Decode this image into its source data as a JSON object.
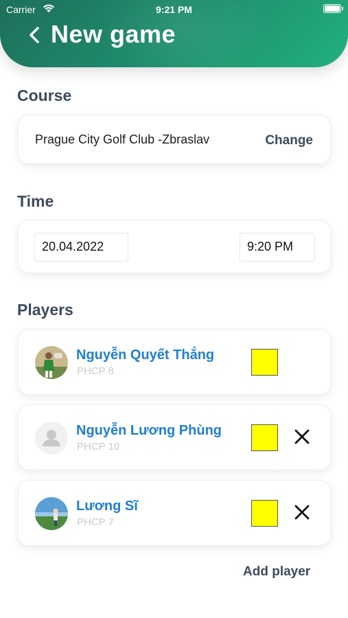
{
  "status_bar": {
    "carrier": "Carrier",
    "time": "9:21 PM"
  },
  "header": {
    "title": "New game",
    "back_icon": "chevron-left-icon"
  },
  "course": {
    "label": "Course",
    "name": "Prague City Golf Club -Zbraslav",
    "change_label": "Change"
  },
  "time": {
    "label": "Time",
    "date": "20.04.2022",
    "clock": "9:20 PM"
  },
  "players": {
    "label": "Players",
    "items": [
      {
        "name": "Nguyễn Quyết Thắng",
        "hcp": "PHCP 8",
        "color": "#ffff00",
        "removable": false
      },
      {
        "name": "Nguyễn Lương Phùng",
        "hcp": "PHCP 10",
        "color": "#ffff00",
        "removable": true
      },
      {
        "name": "Lương Sĩ",
        "hcp": "PHCP 7",
        "color": "#ffff00",
        "removable": true
      }
    ],
    "add_label": "Add player"
  },
  "colors": {
    "accent_green": "#1d8a6c",
    "player_name_blue": "#1f7fd0",
    "marker_yellow": "#ffff00"
  }
}
